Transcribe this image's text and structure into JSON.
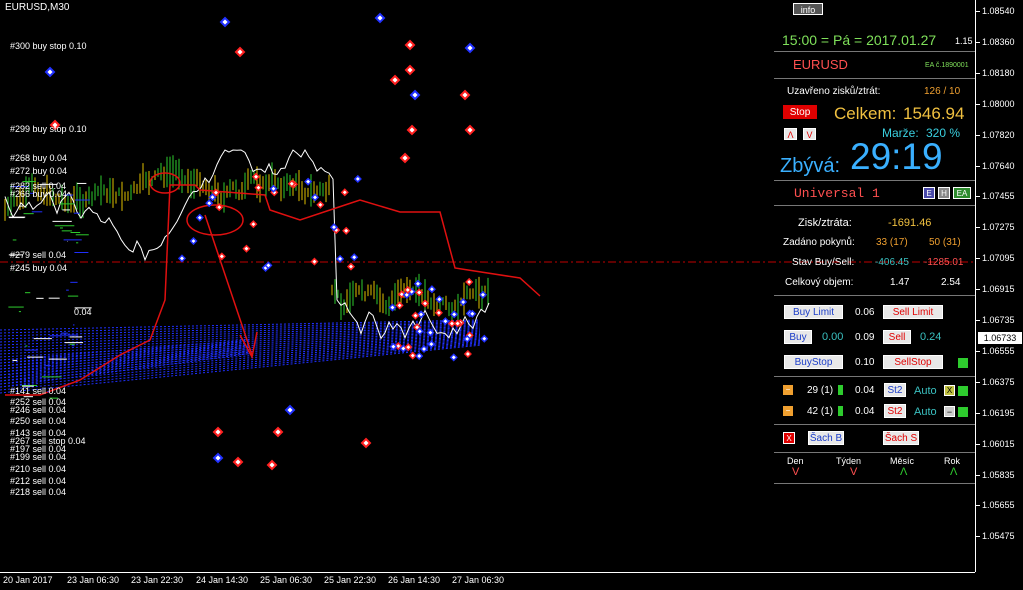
{
  "window": {
    "symbol_title": "EURUSD,M30"
  },
  "order_labels": [
    {
      "text": "#300 buy stop 0.10"
    },
    {
      "text": "#299 buy stop 0.10"
    },
    {
      "text": "#268 buy 0.04"
    },
    {
      "text": "#272 buy 0.04"
    },
    {
      "text": "#282 sell 0.04"
    },
    {
      "text": "#266 buy 0.04"
    },
    {
      "text": "#279 sell 0.04"
    },
    {
      "text": "#245 buy 0.04"
    },
    {
      "text": "0.04"
    },
    {
      "text": "#141 sell 0.04"
    },
    {
      "text": "#252 sell 0.04"
    },
    {
      "text": "#246 sell 0.04"
    },
    {
      "text": "#250 sell 0.04"
    },
    {
      "text": "#143 sell 0.04"
    },
    {
      "text": "#267 sell stop 0.04"
    },
    {
      "text": "#197 sell 0.04"
    },
    {
      "text": "#199 sell 0.04"
    },
    {
      "text": "#210 sell 0.04"
    },
    {
      "text": "#212 sell 0.04"
    },
    {
      "text": "#218 sell 0.04"
    }
  ],
  "price_axis": {
    "ticks": [
      "1.08540",
      "1.08360",
      "1.08180",
      "1.08000",
      "1.07820",
      "1.07640",
      "1.07455",
      "1.07275",
      "1.07095",
      "1.06915",
      "1.06735",
      "1.06555",
      "1.06375",
      "1.06195",
      "1.06015",
      "1.05835",
      "1.05655",
      "1.05475"
    ],
    "current_price": "1.06733"
  },
  "time_axis": {
    "ticks": [
      "20 Jan 2017",
      "23 Jan 06:30",
      "23 Jan 22:30",
      "24 Jan 14:30",
      "25 Jan 06:30",
      "25 Jan 22:30",
      "26 Jan 14:30",
      "27 Jan 06:30"
    ]
  },
  "panel": {
    "info_button": "info",
    "datetime": "15:00 = Pá = 2017.01.27",
    "version": "1.15",
    "symbol": "EURUSD",
    "ea_number": "EA č.1890001",
    "closed_label": "Uzavřeno zisků/ztrát:",
    "closed_value": "126 / 10",
    "stop_button": "Stop",
    "total_label": "Celkem:",
    "total_value": "1546.94",
    "margin_label": "Marže:",
    "margin_value": "320 %",
    "remaining_label": "Zbývá:",
    "remaining_value": "29:19",
    "strategy_name": "Universal 1",
    "btn_e": "E",
    "btn_h": "H",
    "btn_ea": "EA",
    "btn_lambda": "Λ",
    "btn_v": "V",
    "pl_label": "Zisk/ztráta:",
    "pl_value": "-1691.46",
    "orders_label": "Zadáno pokynů:",
    "orders_buy": "33 (17)",
    "orders_sell": "50 (31)",
    "state_label": "Stav Buy/Sell:",
    "state_buy": "-406.45",
    "state_sell": "-1285.01",
    "volume_label": "Celkový objem:",
    "volume_buy": "1.47",
    "volume_sell": "2.54",
    "buy_limit_btn": "Buy Limit",
    "buy_limit_val": "0.06",
    "sell_limit_btn": "Sell Limit",
    "buy_btn": "Buy",
    "buy_val": "0.00",
    "mid_val": "0.09",
    "sell_btn": "Sell",
    "sell_val": "0.24",
    "buy_stop_btn": "BuyStop",
    "stop_val": "0.10",
    "sell_stop_btn": "SellStop",
    "row1_count": "29 (1)",
    "row1_lot": "0.04",
    "row1_st": "St2",
    "row1_auto": "Auto",
    "row1_x": "X",
    "row2_count": "42 (1)",
    "row2_lot": "0.04",
    "row2_st": "St2",
    "row2_auto": "Auto",
    "row2_minus": "−",
    "close_x": "X",
    "sach_b": "Šach B",
    "sach_s": "Šach S",
    "period_day": "Den",
    "period_week": "Týden",
    "period_month": "Měsíc",
    "period_year": "Rok",
    "arrow_down": "V",
    "arrow_up": "Λ"
  },
  "colors": {
    "datetime": "#7fe05a",
    "symbol": "#ff5050",
    "total": "#f0c040",
    "remaining": "#3ab0ff",
    "margin": "#3ad0e0",
    "negative": "#ff5050",
    "orange": "#f0a030",
    "cyan": "#3ac0c0"
  }
}
